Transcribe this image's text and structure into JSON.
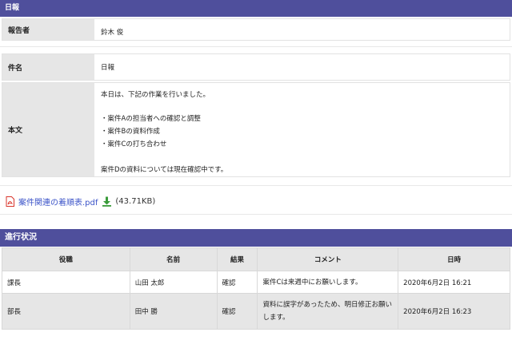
{
  "header": {
    "title": "日報"
  },
  "report": {
    "reporter_label": "報告者",
    "reporter_value": "鈴木 俊",
    "subject_label": "件名",
    "subject_value": "日報",
    "body_label": "本文",
    "body_lines": [
      "本日は、下記の作業を行いました。",
      "",
      "・案件Aの担当者への確認と調整",
      "・案件Bの資料作成",
      "・案件Cの打ち合わせ",
      "",
      "案件Dの資料については現在確認中です。"
    ]
  },
  "attachment": {
    "icon": "pdf-icon",
    "filename": "案件関連の着順表.pdf",
    "download_icon": "download-icon",
    "size": "(43.71KB)"
  },
  "progress": {
    "title": "進行状況",
    "columns": [
      "役職",
      "名前",
      "結果",
      "コメント",
      "日時"
    ],
    "rows": [
      {
        "role": "課長",
        "name": "山田 太郎",
        "result": "確認",
        "comment": "案件Cは来週中にお願いします。",
        "datetime": "2020年6月2日 16:21"
      },
      {
        "role": "部長",
        "name": "田中 勝",
        "result": "確認",
        "comment": "資料に誤字があったため、明日修正お願いします。",
        "datetime": "2020年6月2日 16:23"
      }
    ]
  },
  "colors": {
    "header_bar": "#4f4f9c",
    "label_bg": "#e6e6e6",
    "link": "#3b53c8",
    "pdf_red": "#d9342b",
    "download_green": "#3a9b3a"
  }
}
